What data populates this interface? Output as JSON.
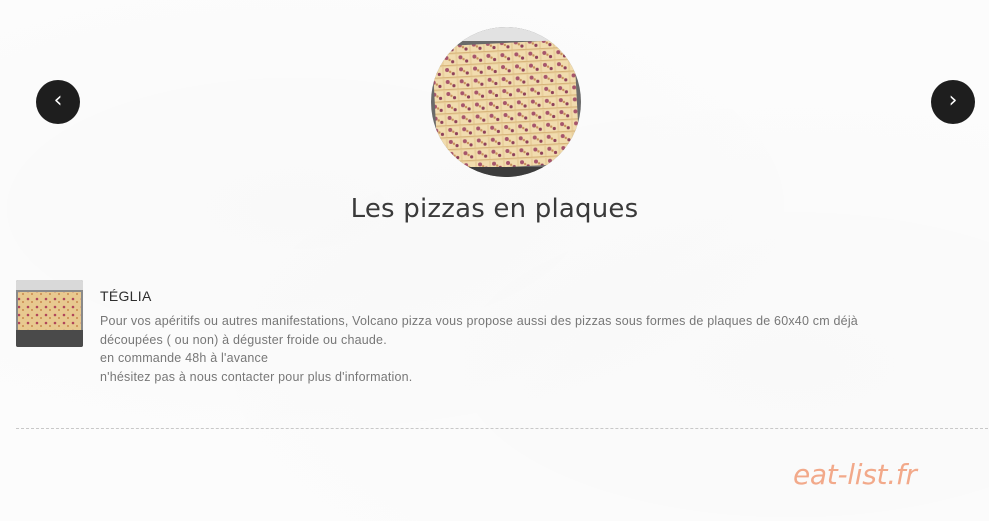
{
  "carousel": {
    "prev_glyph": "‹",
    "next_glyph": "›",
    "hero_image_icon": "pizza-tray-photo"
  },
  "section": {
    "title": "Les pizzas en plaques"
  },
  "item": {
    "name": "TÉGLIA",
    "thumbnail_icon": "pizza-tray-photo",
    "description_lines": [
      "Pour vos apéritifs ou autres manifestations, Volcano pizza vous propose aussi des pizzas sous formes de plaques de 60x40 cm déjà",
      "découpées ( ou non) à déguster froide ou chaude.",
      "en commande 48h à l'avance",
      "n'hésitez pas à nous contacter pour plus d'information."
    ]
  },
  "watermark": {
    "text": "eat-list.fr"
  },
  "colors": {
    "nav_button": "#1e1e1e",
    "watermark": "#f2a98a",
    "divider": "#c8c8c8"
  }
}
